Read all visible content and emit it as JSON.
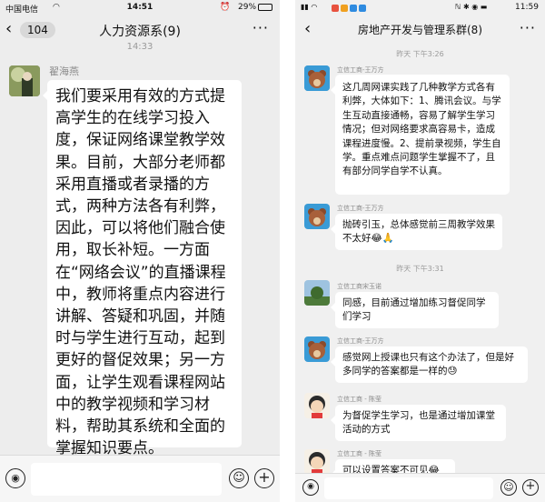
{
  "left": {
    "status": {
      "carrier": "中国电信",
      "time": "14:51",
      "battery": "29%"
    },
    "nav": {
      "back_count": "104",
      "title": "人力资源系(9)"
    },
    "peek_time": "14:33",
    "message": {
      "sender": "翟海燕",
      "text": "我们要采用有效的方式提高学生的在线学习投入度，保证网络课堂教学效果。目前，大部分老师都采用直播或者录播的方式，两种方法各有利弊，因此，可以将他们融合使用，取长补短。一方面在“网络会议”的直播课程中，教师将重点内容进行讲解、答疑和巩固，并随时与学生进行互动，起到更好的督促效果；另一方面，让学生观看课程网站中的教学视频和学习材料，帮助其系统和全面的掌握知识要点。"
    }
  },
  "right": {
    "status": {
      "time": "11:59"
    },
    "nav": {
      "title": "房地产开发与管理系群(8)"
    },
    "ts1": "昨天 下午3:26",
    "ts2": "昨天 下午3:31",
    "messages": [
      {
        "sender": "立信工商-王万方",
        "text": "这几周网课实践了几种教学方式各有利弊，大体如下：1、腾讯会议。与学生互动直接通畅，容易了解学生学习情况；但对网络要求高容易卡，造成课程进度慢。2、提前录视频，学生自学。重点难点问题学生掌握不了，且有部分同学自学不认真。"
      },
      {
        "sender": "立信工商-王万方",
        "text": "抛砖引玉，总体感觉前三周教学效果不太好😂🙏"
      },
      {
        "sender": "立信工商宋玉诺",
        "text": "同感，目前通过增加练习督促同学们学习"
      },
      {
        "sender": "立信工商-王万方",
        "text": "感觉网上授课也只有这个办法了，但是好多同学的答案都是一样的😓"
      },
      {
        "sender": "立信工商 - 陈莹",
        "text": "为督促学生学习，也是通过增加课堂活动的方式"
      },
      {
        "sender": "立信工商 - 陈莹",
        "text": "可以设置答案不可见😂"
      }
    ]
  }
}
